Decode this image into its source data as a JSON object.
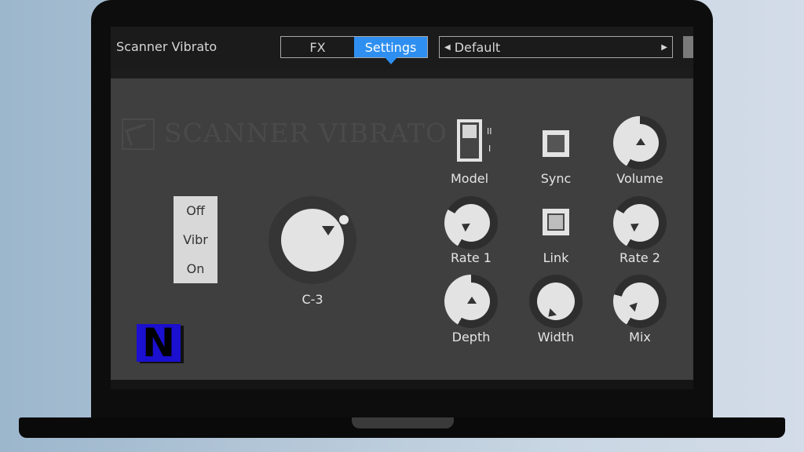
{
  "plugin": {
    "title": "Scanner Vibrato",
    "tabs": [
      {
        "label": "FX",
        "active": false
      },
      {
        "label": "Settings",
        "active": true
      }
    ],
    "preset": "Default",
    "logo_text": "SCANNER VIBRATO",
    "brand_letter": "N",
    "accent_color": "#2e8ff0"
  },
  "mode_switch": {
    "options": [
      "Off",
      "Vibr",
      "On"
    ]
  },
  "main_knob": {
    "label": "C-3"
  },
  "controls": {
    "model": {
      "label": "Model",
      "marks": [
        "II",
        "I"
      ]
    },
    "sync": {
      "label": "Sync",
      "state": "off"
    },
    "volume": {
      "label": "Volume"
    },
    "rate1": {
      "label": "Rate 1"
    },
    "link": {
      "label": "Link",
      "state": "on"
    },
    "rate2": {
      "label": "Rate 2"
    },
    "depth": {
      "label": "Depth"
    },
    "width": {
      "label": "Width"
    },
    "mix": {
      "label": "Mix"
    }
  }
}
